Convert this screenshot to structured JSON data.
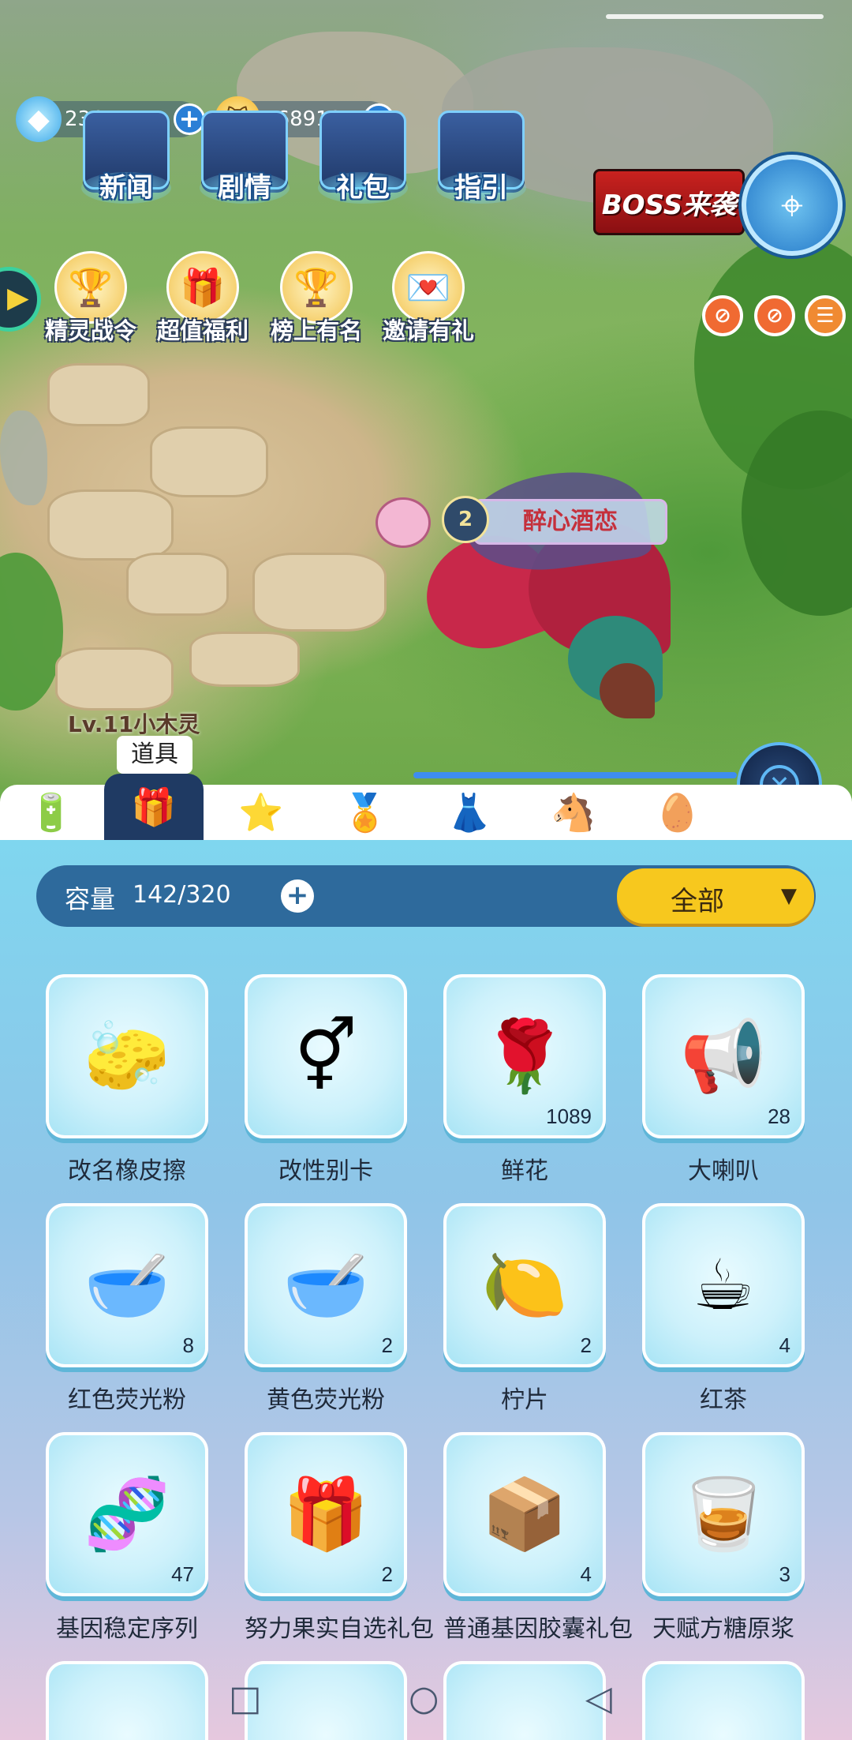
{
  "status": {},
  "currency": {
    "gems": "236",
    "coins": "168918"
  },
  "top_menu": [
    "新闻",
    "剧情",
    "礼包",
    "指引"
  ],
  "events": [
    "精灵战令",
    "超值福利",
    "榜上有名",
    "邀请有礼"
  ],
  "boss_banner": "BOSS来袭",
  "pet": {
    "level": "2",
    "name": "醉心酒恋"
  },
  "player": {
    "tag": "Lv.11小木灵"
  },
  "tooltip": "道具",
  "tabs": [
    {
      "icon": "battery-icon",
      "glyph": "🔋"
    },
    {
      "icon": "items-icon",
      "glyph": "🎁",
      "active": true
    },
    {
      "icon": "star-wand-icon",
      "glyph": "⭐"
    },
    {
      "icon": "badge-icon",
      "glyph": "🏅"
    },
    {
      "icon": "dress-icon",
      "glyph": "👗"
    },
    {
      "icon": "rocking-horse-icon",
      "glyph": "🐴"
    },
    {
      "icon": "egg-icon",
      "glyph": "🥚"
    }
  ],
  "inventory": {
    "capacity_label": "容量",
    "capacity_value": "142/320",
    "filter": "全部",
    "items": [
      {
        "name": "改名橡皮擦",
        "count": "",
        "glyph": "🧽"
      },
      {
        "name": "改性别卡",
        "count": "",
        "glyph": "⚥"
      },
      {
        "name": "鲜花",
        "count": "1089",
        "glyph": "🌹"
      },
      {
        "name": "大喇叭",
        "count": "28",
        "glyph": "📢"
      },
      {
        "name": "红色荧光粉",
        "count": "8",
        "glyph": "🥣"
      },
      {
        "name": "黄色荧光粉",
        "count": "2",
        "glyph": "🥣"
      },
      {
        "name": "柠片",
        "count": "2",
        "glyph": "🍋"
      },
      {
        "name": "红茶",
        "count": "4",
        "glyph": "☕"
      },
      {
        "name": "基因稳定序列",
        "count": "47",
        "glyph": "🧬"
      },
      {
        "name": "努力果实自选礼包",
        "count": "2",
        "glyph": "🎁"
      },
      {
        "name": "普通基因胶囊礼包",
        "count": "4",
        "glyph": "📦"
      },
      {
        "name": "天赋方糖原浆",
        "count": "3",
        "glyph": "🥃"
      }
    ]
  },
  "nav": {
    "square": "□",
    "circle": "○",
    "back": "◁"
  }
}
